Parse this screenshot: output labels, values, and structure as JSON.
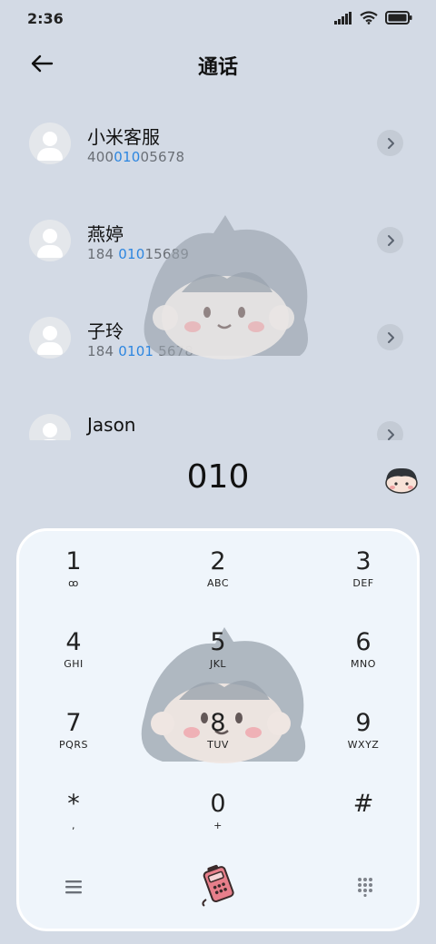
{
  "status": {
    "time": "2:36"
  },
  "header": {
    "title": "通话"
  },
  "contacts": [
    {
      "name": "小米客服",
      "number_pre": "400",
      "number_hl": "010",
      "number_post": "05678"
    },
    {
      "name": "燕婷",
      "number_pre": "184 ",
      "number_hl": "010",
      "number_post": "15689"
    },
    {
      "name": "子玲",
      "number_pre": "184 ",
      "number_hl": "0101",
      "number_post": " 5678"
    },
    {
      "name": "Jason",
      "number_pre": "",
      "number_hl": "",
      "number_post": ""
    }
  ],
  "dialer": {
    "number": "010"
  },
  "keypad": {
    "keys": [
      {
        "digit": "1",
        "letters": "ꝏ"
      },
      {
        "digit": "2",
        "letters": "ABC"
      },
      {
        "digit": "3",
        "letters": "DEF"
      },
      {
        "digit": "4",
        "letters": "GHI"
      },
      {
        "digit": "5",
        "letters": "JKL"
      },
      {
        "digit": "6",
        "letters": "MNO"
      },
      {
        "digit": "7",
        "letters": "PQRS"
      },
      {
        "digit": "8",
        "letters": "TUV"
      },
      {
        "digit": "9",
        "letters": "WXYZ"
      },
      {
        "digit": "*",
        "letters": ","
      },
      {
        "digit": "0",
        "letters": "+"
      },
      {
        "digit": "#",
        "letters": ""
      }
    ]
  },
  "icons": {
    "back": "arrow-left-icon",
    "chevron": "chevron-right-icon",
    "menu": "menu-icon",
    "call": "phone-call-icon",
    "keypad_toggle": "dialpad-icon",
    "signal": "signal-icon",
    "wifi": "wifi-icon",
    "battery": "battery-icon"
  },
  "colors": {
    "background": "#d3dae5",
    "highlight": "#2d86e0",
    "keypad_bg": "#eff5fb"
  }
}
